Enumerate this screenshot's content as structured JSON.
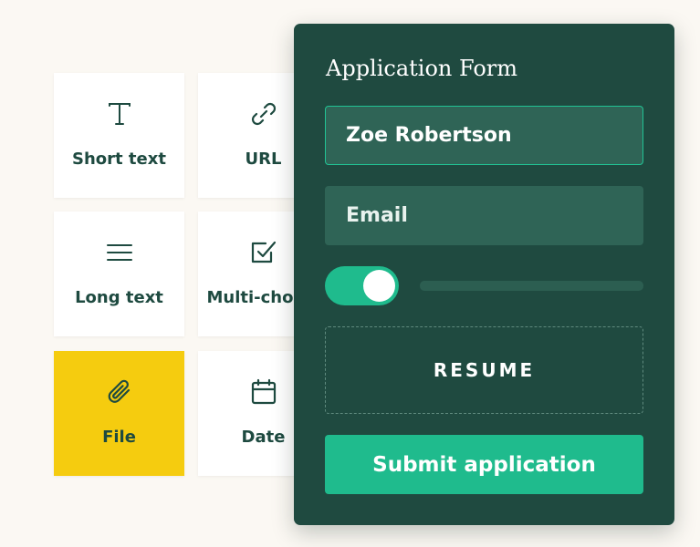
{
  "colors": {
    "page_background": "#fbf8f3",
    "panel_background": "#1f4a40",
    "accent": "#1fbb8d",
    "selected_tile": "#f5cc0f",
    "tile_label": "#1e4a40"
  },
  "field_types": [
    {
      "label": "Short text",
      "icon": "text-icon",
      "selected": false
    },
    {
      "label": "URL",
      "icon": "link-icon",
      "selected": false
    },
    {
      "label": "Long text",
      "icon": "lines-icon",
      "selected": false
    },
    {
      "label": "Multi-choice",
      "icon": "checkbox-icon",
      "selected": false
    },
    {
      "label": "File",
      "icon": "paperclip-icon",
      "selected": true
    },
    {
      "label": "Date",
      "icon": "calendar-icon",
      "selected": false
    }
  ],
  "form": {
    "title": "Application Form",
    "name_value": "Zoe Robertson",
    "email_placeholder": "Email",
    "toggle_on": true,
    "upload_label": "RESUME",
    "submit_label": "Submit application"
  }
}
